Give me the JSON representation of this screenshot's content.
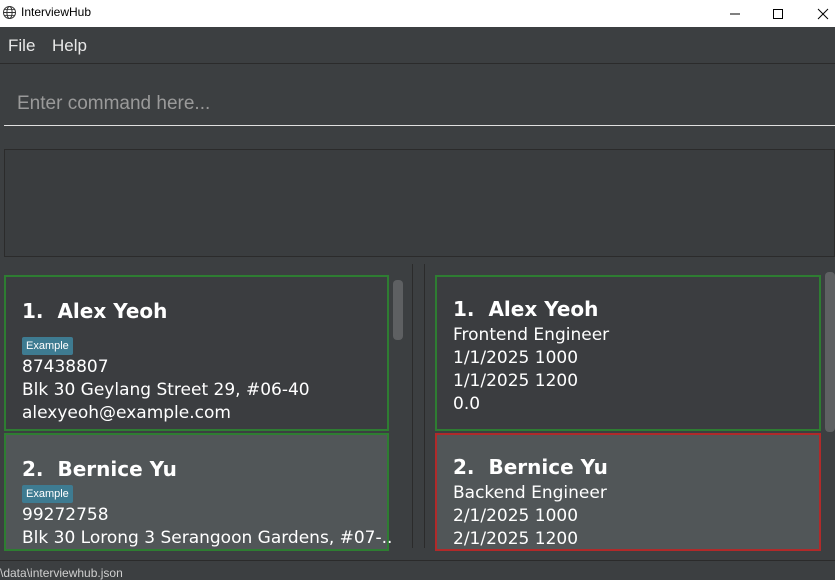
{
  "window": {
    "title": "InterviewHub",
    "icon": "globe-icon"
  },
  "menu": {
    "items": [
      {
        "label": "File"
      },
      {
        "label": "Help"
      }
    ]
  },
  "command": {
    "placeholder": "Enter command here...",
    "value": ""
  },
  "result": {
    "text": ""
  },
  "persons": [
    {
      "index": "1.",
      "name": "Alex Yeoh",
      "tag": "Example",
      "phone": "87438807",
      "address": "Blk 30 Geylang Street 29, #06-40",
      "email": "alexyeoh@example.com"
    },
    {
      "index": "2.",
      "name": "Bernice Yu",
      "tag": "Example",
      "phone": "99272758",
      "address": "Blk 30 Lorong 3 Serangoon Gardens, #07-..."
    }
  ],
  "interviews": [
    {
      "index": "1.",
      "name": "Alex Yeoh",
      "role": "Frontend Engineer",
      "start": "1/1/2025 1000",
      "end": "1/1/2025 1200",
      "score": "0.0",
      "status_color": "#2e7d32"
    },
    {
      "index": "2.",
      "name": "Bernice Yu",
      "role": "Backend Engineer",
      "start": "2/1/2025 1000",
      "end": "2/1/2025 1200",
      "status_color": "#b02a2a"
    }
  ],
  "status": {
    "path": "\\data\\interviewhub.json"
  }
}
